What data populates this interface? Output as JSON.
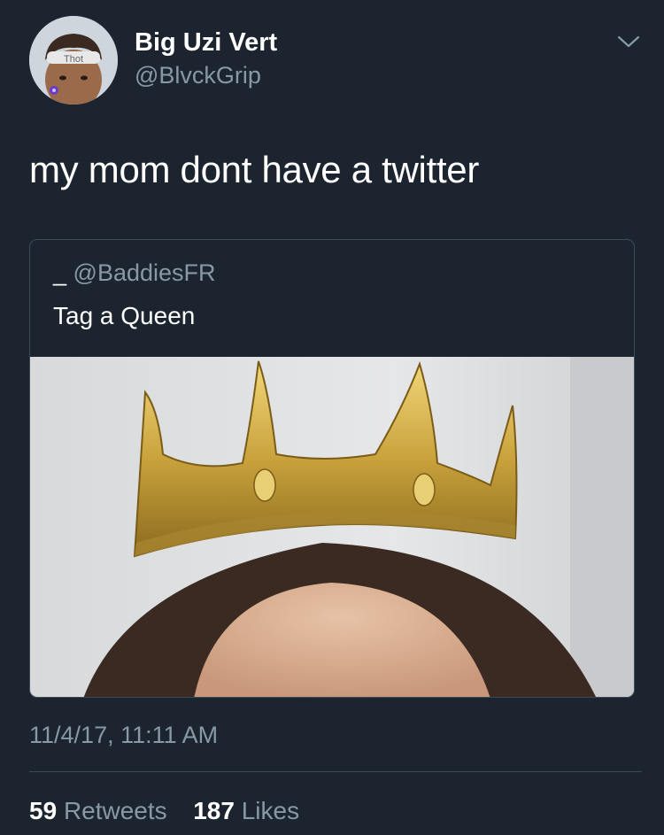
{
  "tweet": {
    "author_name": "Big Uzi Vert",
    "author_handle": "@BlvckGrip",
    "avatar_text": "Thot",
    "text": "my mom dont have a twitter",
    "timestamp": "11/4/17, 11:11 AM"
  },
  "quoted_tweet": {
    "author_name": "_",
    "author_handle": "@BaddiesFR",
    "text": "Tag a Queen",
    "media_description": "crown-photo"
  },
  "stats": {
    "retweets_count": "59",
    "retweets_label": "Retweets",
    "likes_count": "187",
    "likes_label": "Likes"
  },
  "colors": {
    "background": "#1c2430",
    "secondary_text": "#8899a6",
    "border": "#3d4a58"
  }
}
